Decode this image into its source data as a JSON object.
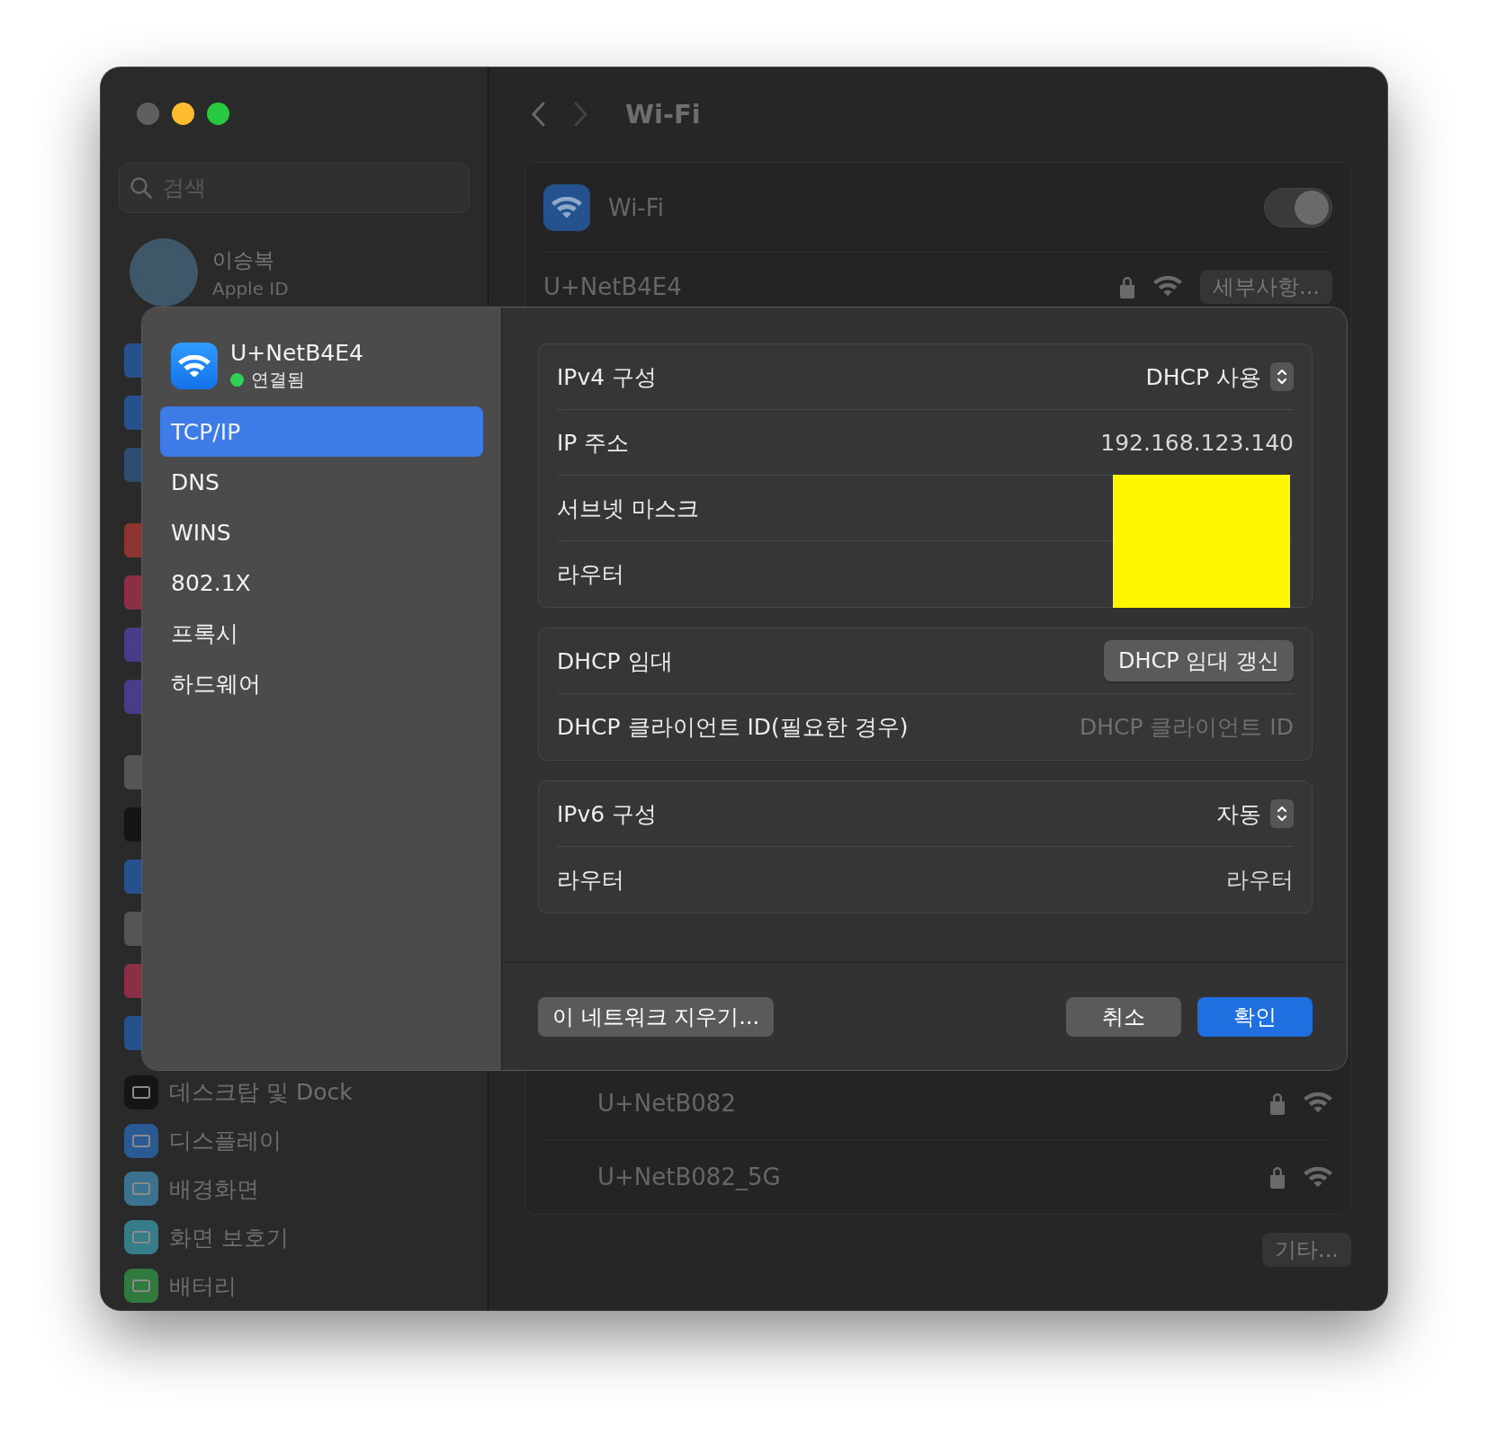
{
  "window": {
    "traffic_lights": [
      {
        "color": "#5f5f5f"
      },
      {
        "color": "#febc2e"
      },
      {
        "color": "#28c840"
      }
    ]
  },
  "sidebar": {
    "search": {
      "placeholder": "검색"
    },
    "account": {
      "name": "이승복",
      "subtitle": "Apple ID"
    },
    "covered_icon_groups": [
      [
        {
          "color": "#27518c"
        },
        {
          "color": "#27518c"
        },
        {
          "color": "#2e4c70"
        }
      ],
      [
        {
          "color": "#8c3530"
        },
        {
          "color": "#8a2f45"
        },
        {
          "color": "#4a3c88"
        },
        {
          "color": "#4a3c88"
        }
      ],
      [
        {
          "color": "#555555"
        },
        {
          "color": "#151515"
        },
        {
          "color": "#27518c"
        },
        {
          "color": "#555555"
        },
        {
          "color": "#8a2f45"
        },
        {
          "color": "#27518c"
        }
      ]
    ],
    "items": [
      {
        "label": "데스크탑 및 Dock",
        "color": "#151515"
      },
      {
        "label": "디스플레이",
        "color": "#2a5a94"
      },
      {
        "label": "배경화면",
        "color": "#3a7290"
      },
      {
        "label": "화면 보호기",
        "color": "#367d8a"
      },
      {
        "label": "배터리",
        "color": "#2f7a3c"
      }
    ]
  },
  "main": {
    "title": "Wi-Fi",
    "wifi": {
      "label": "Wi-Fi",
      "on": true
    },
    "current_network": {
      "name": "U+NetB4E4",
      "details_button": "세부사항..."
    },
    "other_networks": [
      {
        "name": "U+NetB082"
      },
      {
        "name": "U+NetB082_5G"
      }
    ],
    "other_button": "기타..."
  },
  "sheet": {
    "network": {
      "name": "U+NetB4E4",
      "status": "연결됨"
    },
    "tabs": [
      {
        "label": "TCP/IP",
        "selected": true
      },
      {
        "label": "DNS",
        "selected": false
      },
      {
        "label": "WINS",
        "selected": false
      },
      {
        "label": "802.1X",
        "selected": false
      },
      {
        "label": "프록시",
        "selected": false
      },
      {
        "label": "하드웨어",
        "selected": false
      }
    ],
    "groups": [
      [
        {
          "kind": "popup",
          "label": "IPv4 구성",
          "value": "DHCP 사용"
        },
        {
          "kind": "value",
          "label": "IP 주소",
          "value": "192.168.123.140"
        },
        {
          "kind": "redacted",
          "label": "서브넷 마스크"
        },
        {
          "kind": "redacted",
          "label": "라우터"
        }
      ],
      [
        {
          "kind": "button",
          "label": "DHCP 임대",
          "value": "DHCP 임대 갱신"
        },
        {
          "kind": "field",
          "label": "DHCP 클라이언트 ID(필요한 경우)",
          "placeholder": "DHCP 클라이언트 ID"
        }
      ],
      [
        {
          "kind": "popup",
          "label": "IPv6 구성",
          "value": "자동"
        },
        {
          "kind": "value",
          "label": "라우터",
          "value": "라우터"
        }
      ]
    ],
    "forget_button": "이 네트워크 지우기...",
    "cancel_button": "취소",
    "ok_button": "확인"
  }
}
